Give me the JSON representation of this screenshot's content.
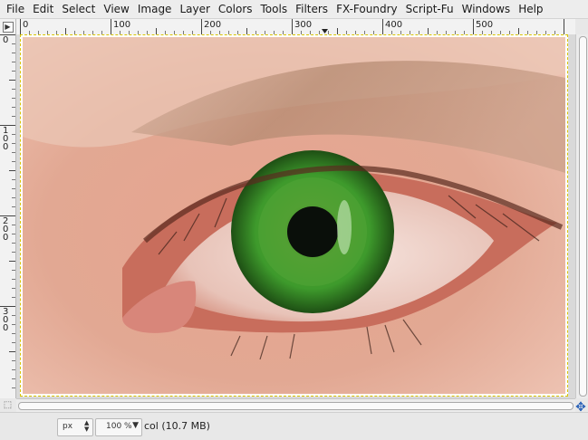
{
  "menu": [
    "File",
    "Edit",
    "Select",
    "View",
    "Image",
    "Layer",
    "Colors",
    "Tools",
    "Filters",
    "FX-Foundry",
    "Script-Fu",
    "Windows",
    "Help"
  ],
  "rulers": {
    "horizontal": [
      "0",
      "100",
      "200",
      "300",
      "400",
      "500"
    ],
    "vertical": [
      "0",
      "100",
      "200",
      "300"
    ]
  },
  "icons": {
    "menu_button": "▶",
    "navigate": "✥",
    "quick_mask": "⬚",
    "zoom_arrow": "▼",
    "unit_arrows": "▲▼"
  },
  "status": {
    "unit": "px",
    "zoom": "100 %",
    "message": "col (10.7 MB)"
  },
  "colors": {
    "iris": "#3e9a2c",
    "selection_border": "#d8c400"
  }
}
